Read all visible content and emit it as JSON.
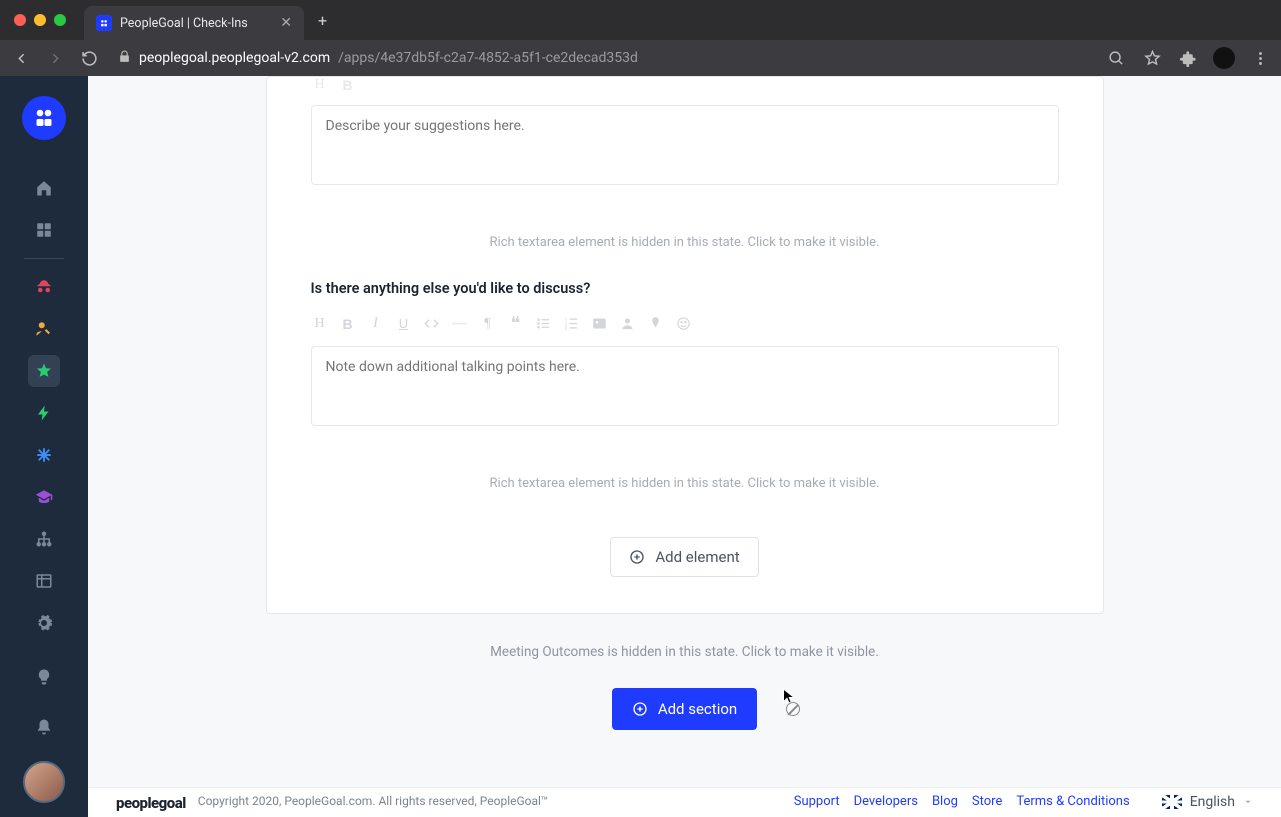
{
  "browser": {
    "tab_title": "PeopleGoal | Check-Ins",
    "url_domain": "peoplegoal.peoplegoal-v2.com",
    "url_path": "/apps/4e37db5f-c2a7-4852-a5f1-ce2decad353d"
  },
  "form": {
    "textarea1_placeholder": "Describe your suggestions here.",
    "hidden_notice1": "Rich textarea element is hidden in this state. Click to make it visible.",
    "question2": "Is there anything else you'd like to discuss?",
    "textarea2_placeholder": "Note down additional talking points here.",
    "hidden_notice2": "Rich textarea element is hidden in this state. Click to make it visible.",
    "add_element_label": "Add element",
    "hidden_section_notice": "Meeting Outcomes is hidden in this state. Click to make it visible.",
    "add_section_label": "Add section"
  },
  "footer": {
    "brand": "peoplegoal",
    "copyright": "Copyright 2020, PeopleGoal.com. All rights reserved, PeopleGoal™",
    "links": {
      "support": "Support",
      "developers": "Developers",
      "blog": "Blog",
      "store": "Store",
      "terms": "Terms & Conditions"
    },
    "language": "English"
  }
}
